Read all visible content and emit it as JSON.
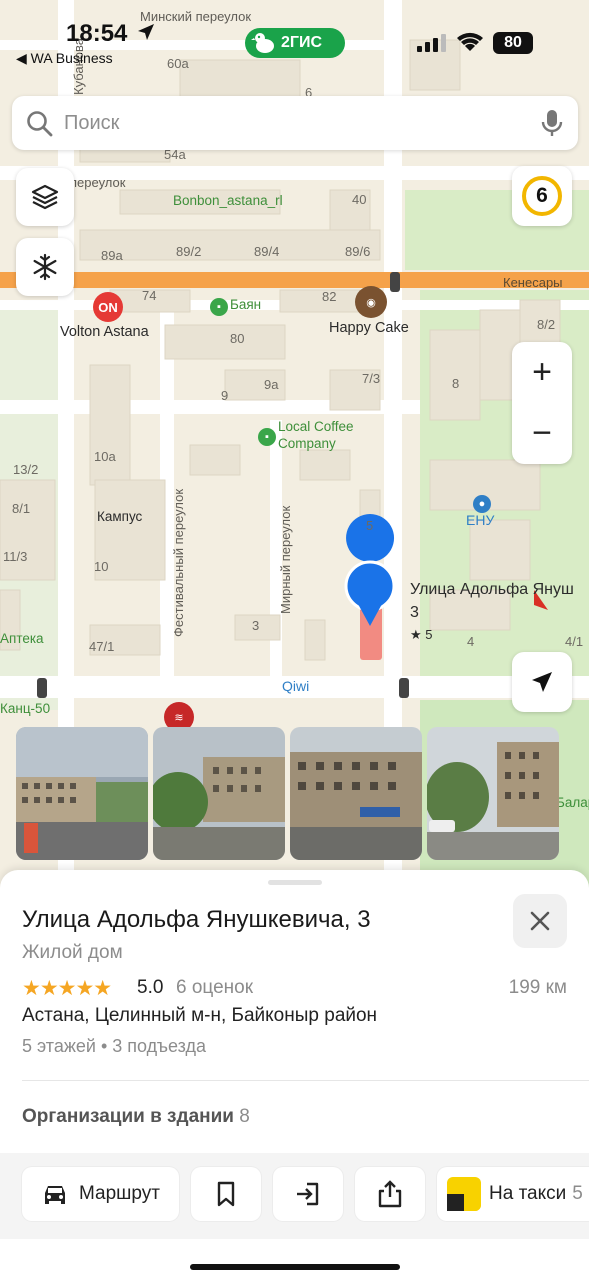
{
  "status_bar": {
    "time": "18:54",
    "back_app": "◀ WA Business",
    "battery": "80"
  },
  "brand": {
    "name": "2ГИС",
    "color": "#1aa34a"
  },
  "search": {
    "placeholder": "Поиск"
  },
  "map": {
    "streets": {
      "minsky": "Минский переулок",
      "kubanova": "Кубанова",
      "kenesary": "Кенесары",
      "festivalny": "Фестивальный переулок",
      "mirny": "Мирный переулок",
      "pereulok": "переулок"
    },
    "house_numbers": [
      "60а",
      "54а",
      "40",
      "89а",
      "89/2",
      "89/4",
      "89/6",
      "74",
      "82",
      "80",
      "7/3",
      "9а",
      "9",
      "8/2",
      "8",
      "10а",
      "13/2",
      "8/1",
      "5",
      "10",
      "11/3",
      "47/1",
      "3",
      "4",
      "4/1",
      "6"
    ],
    "poi": {
      "bonbon": "Bonbon_astana_rl",
      "volton": "Volton Astana",
      "bayan": "Баян",
      "happy_cake": "Happy Cake",
      "local_coffee_1": "Local Coffee",
      "local_coffee_2": "Company",
      "kampus": "Кампус",
      "enu": "ЕНУ",
      "apteka": "Аптека",
      "kants": "Канц-50",
      "qiwi": "Qiwi",
      "selected_1": "Улица Адольфа Януш",
      "selected_2": "3",
      "selected_rating": "★ 5",
      "edge_right": "Балар"
    }
  },
  "controls": {
    "layers": "layers-icon",
    "snow": "snowflake-icon",
    "traffic_score": "6",
    "zoom_in": "+",
    "zoom_out": "−",
    "locate": "locate-arrow-icon"
  },
  "sheet": {
    "title": "Улица Адольфа Янушкевича, 3",
    "type": "Жилой дом",
    "stars": "★★★★★",
    "rating": "5.0",
    "rating_count": "6 оценок",
    "distance": "199 км",
    "address": "Астана, Целинный м-н, Байконыр район",
    "building_info": "5 этажей • 3 подъезда",
    "orgs_label": "Организации в здании",
    "orgs_count": "8"
  },
  "actions": {
    "route": "Маршрут",
    "save": "bookmark-icon",
    "enter": "entrance-icon",
    "share": "share-icon",
    "taxi": "На такси",
    "taxi_suffix": "5"
  },
  "colors": {
    "main_road": "#f5a24a",
    "marker": "#1a73e8",
    "selected_building": "#f28b82",
    "star": "#f5a623"
  }
}
